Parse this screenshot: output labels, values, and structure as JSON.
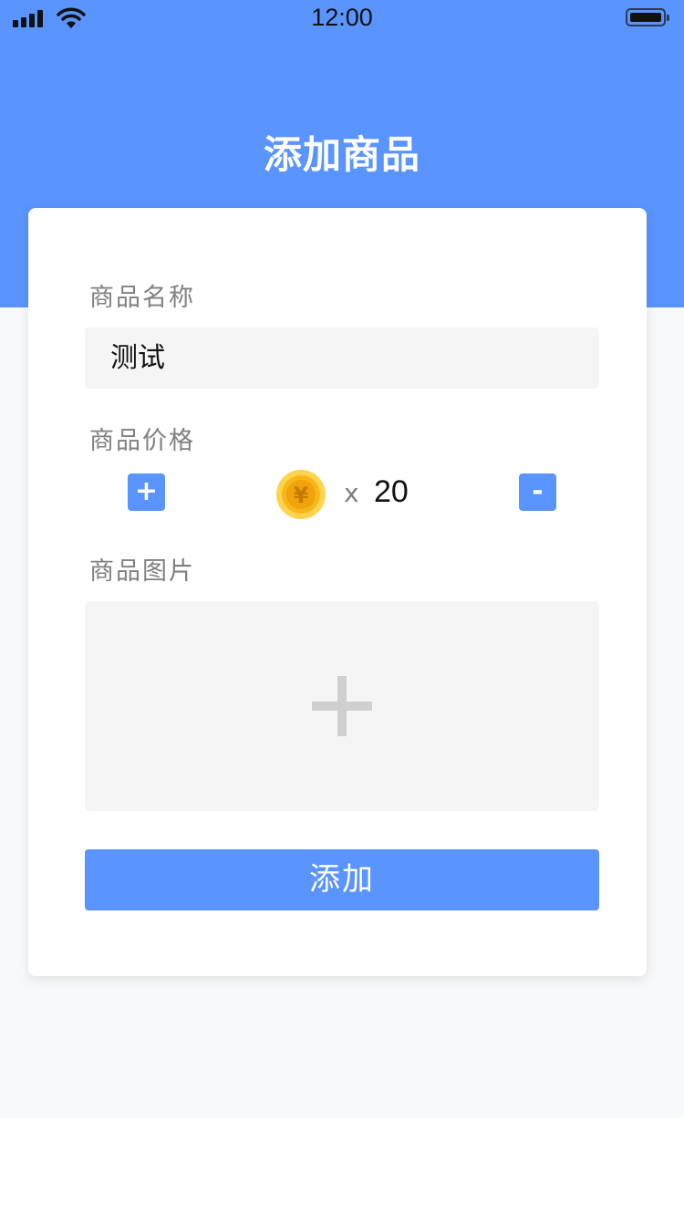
{
  "status_bar": {
    "time": "12:00"
  },
  "header": {
    "title": "添加商品"
  },
  "form": {
    "name_label": "商品名称",
    "name_value": "测试",
    "price_label": "商品价格",
    "increment_label": "+",
    "decrement_label": "-",
    "times_symbol": "x",
    "price_value": "20",
    "coin_symbol": "¥",
    "image_label": "商品图片",
    "submit_label": "添加"
  },
  "colors": {
    "accent": "#5a94ff",
    "coin": "#f7b718",
    "input_bg": "#f5f5f5",
    "page_bg": "#f7f9fa"
  },
  "icons": {
    "signal": "signal-icon",
    "wifi": "wifi-icon",
    "battery": "battery-icon",
    "coin": "coin-icon",
    "upload": "plus-icon"
  }
}
